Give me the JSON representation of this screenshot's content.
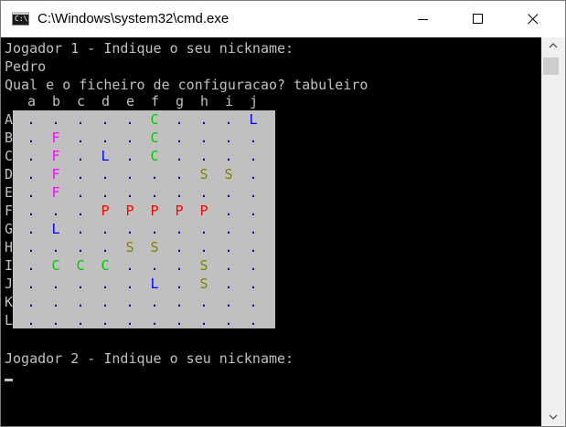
{
  "window": {
    "title": "C:\\Windows\\system32\\cmd.exe",
    "icon_text": "C:\\"
  },
  "console": {
    "lines": [
      "Jogador 1 - Indique o seu nickname:",
      "Pedro",
      "Qual e o ficheiro de configuracao? tabuleiro"
    ],
    "prompt2": "Jogador 2 - Indique o seu nickname:"
  },
  "board": {
    "columns": [
      "a",
      "b",
      "c",
      "d",
      "e",
      "f",
      "g",
      "h",
      "i",
      "j"
    ],
    "rows": [
      "A",
      "B",
      "C",
      "D",
      "E",
      "F",
      "G",
      "H",
      "I",
      "J",
      "K",
      "L"
    ],
    "cells": [
      [
        ".",
        ".",
        ".",
        ".",
        ".",
        "C",
        ".",
        ".",
        ".",
        "L"
      ],
      [
        ".",
        "F",
        ".",
        ".",
        ".",
        "C",
        ".",
        ".",
        ".",
        "."
      ],
      [
        ".",
        "F",
        ".",
        "L",
        ".",
        "C",
        ".",
        ".",
        ".",
        "."
      ],
      [
        ".",
        "F",
        ".",
        ".",
        ".",
        ".",
        ".",
        "S",
        "S",
        "."
      ],
      [
        ".",
        "F",
        ".",
        ".",
        ".",
        ".",
        ".",
        ".",
        ".",
        "."
      ],
      [
        ".",
        ".",
        ".",
        "P",
        "P",
        "P",
        "P",
        "P",
        ".",
        "."
      ],
      [
        ".",
        "L",
        ".",
        ".",
        ".",
        ".",
        ".",
        ".",
        ".",
        "."
      ],
      [
        ".",
        ".",
        ".",
        ".",
        "S",
        "S",
        ".",
        ".",
        ".",
        "."
      ],
      [
        ".",
        "C",
        "C",
        "C",
        ".",
        ".",
        ".",
        "S",
        ".",
        "."
      ],
      [
        ".",
        ".",
        ".",
        ".",
        ".",
        "L",
        ".",
        "S",
        ".",
        "."
      ],
      [
        ".",
        ".",
        ".",
        ".",
        ".",
        ".",
        ".",
        ".",
        ".",
        "."
      ],
      [
        ".",
        ".",
        ".",
        ".",
        ".",
        ".",
        ".",
        ".",
        ".",
        "."
      ]
    ],
    "colors": {
      ".": "#0000a8",
      "L": "#0000ff",
      "C": "#00c800",
      "F": "#ff00ff",
      "P": "#ff0000",
      "S": "#808000"
    },
    "background": "#c0c0c0"
  },
  "icons": [
    "minimize-icon",
    "maximize-icon",
    "close-icon",
    "scroll-up-icon",
    "scroll-down-icon"
  ]
}
